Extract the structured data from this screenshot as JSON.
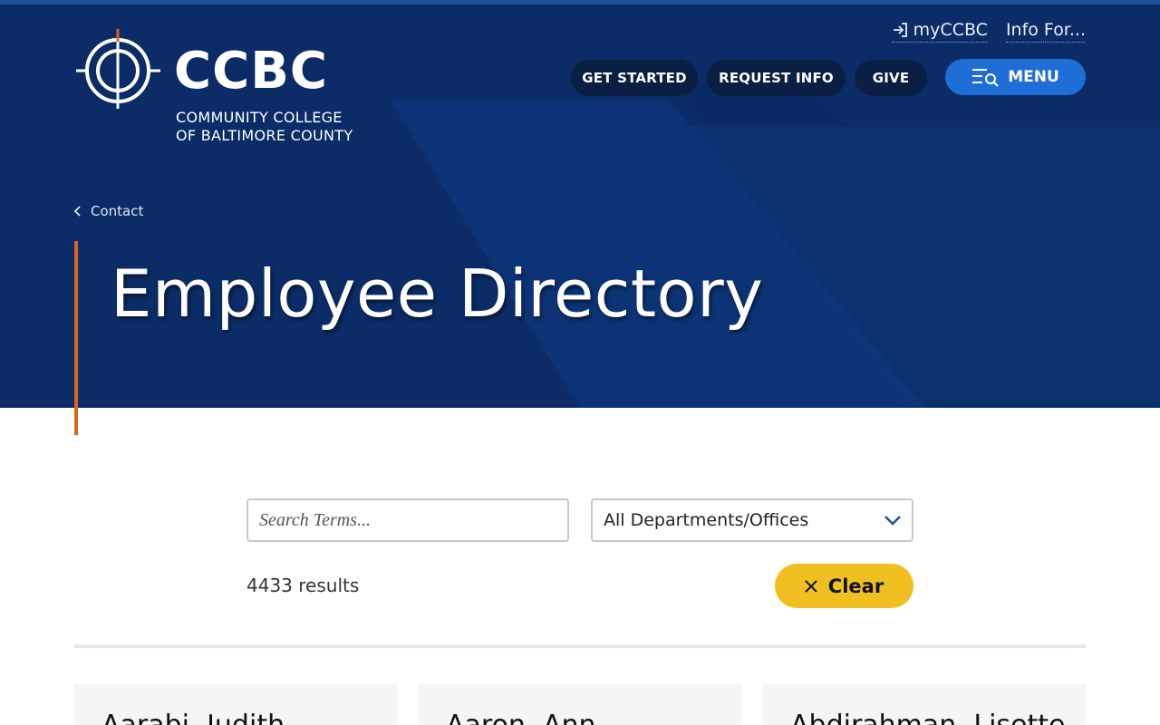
{
  "header": {
    "logo_word": "CCBC",
    "logo_sub_line1": "COMMUNITY COLLEGE",
    "logo_sub_line2": "OF BALTIMORE COUNTY",
    "util_links": [
      {
        "label": "myCCBC",
        "icon": "sign-in-icon"
      },
      {
        "label": "Info For..."
      }
    ],
    "nav_buttons": [
      "GET STARTED",
      "REQUEST INFO",
      "GIVE"
    ],
    "menu_button": {
      "label": "MENU",
      "icon": "menu-search-icon"
    }
  },
  "breadcrumb": {
    "label": "Contact",
    "icon": "chevron-left-icon"
  },
  "page_title": "Employee Directory",
  "filters": {
    "search_placeholder": "Search Terms...",
    "department_select": "All Departments/Offices"
  },
  "results": {
    "count": "4433",
    "label": "results"
  },
  "clear_button": {
    "label": "Clear",
    "icon": "close-icon"
  },
  "cards": [
    {
      "name": "Aarabi, Judith"
    },
    {
      "name": "Aaron, Ann"
    },
    {
      "name": "Abdirahman, Lisette"
    }
  ],
  "colors": {
    "hero_bg": "#0b2c66",
    "accent_orange": "#d9641e",
    "menu_blue": "#1f6ed8",
    "clear_yellow": "#f0c022"
  }
}
